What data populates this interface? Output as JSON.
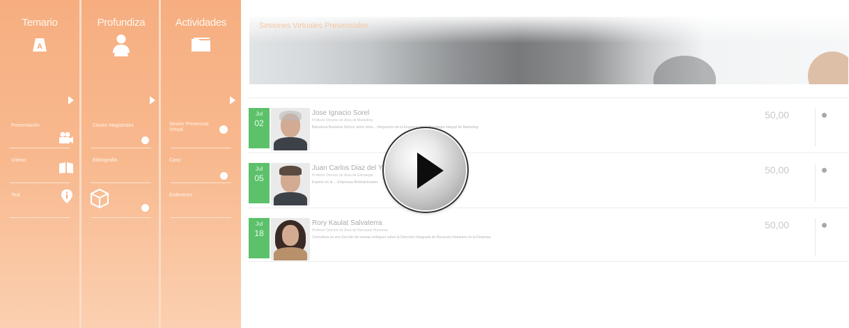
{
  "columns": [
    {
      "title": "Temario",
      "icon": "book-a-icon",
      "items": [
        {
          "label": "Presentación",
          "icon": "video-camera-icon"
        },
        {
          "label": "Vídeos",
          "icon": "book-open-icon"
        },
        {
          "label": "Test",
          "icon": "info-icon"
        }
      ]
    },
    {
      "title": "Profundiza",
      "icon": "reader-icon",
      "items": [
        {
          "label": "Clases Magistrales",
          "icon": "dot-icon"
        },
        {
          "label": "Bibliografía",
          "icon": ""
        },
        {
          "label": "",
          "icon": "cube-icon"
        }
      ]
    },
    {
      "title": "Actividades",
      "icon": "folder-icon",
      "items": [
        {
          "label": "Sesión Presencial Virtual",
          "icon": "dot-icon"
        },
        {
          "label": "Caso",
          "icon": "dot-icon"
        },
        {
          "label": "Exámenes",
          "icon": ""
        }
      ]
    }
  ],
  "banner": {
    "title": "Sesiones Virtuales Presenciales"
  },
  "sessions": [
    {
      "month": "Jul",
      "day": "02",
      "name": "Jose Ignacio Sorel",
      "role": "Profesor Director de Área de Marketing",
      "desc": "Barcelona Business School, entre otros... Integración de la Empresa con la Estrategia Integral de Marketing",
      "price": "50,00"
    },
    {
      "month": "Jul",
      "day": "05",
      "name": "Juan Carlos Diaz del Y",
      "role": "Profesor Director de Área de Estrategia",
      "desc": "Experto en la ... Empresas Multinacionales",
      "price": "50,00"
    },
    {
      "month": "Jul",
      "day": "18",
      "name": "Rory Kaulat Salvaterra",
      "role": "Profesor Director de Área de Recursos Humanos",
      "desc": "Consultora en una Sección de nuevas enfoques sobre la Dirección Integrada de Recursos Humanos en la Empresa",
      "price": "50,00"
    }
  ],
  "play_button": {
    "icon": "play-icon"
  }
}
